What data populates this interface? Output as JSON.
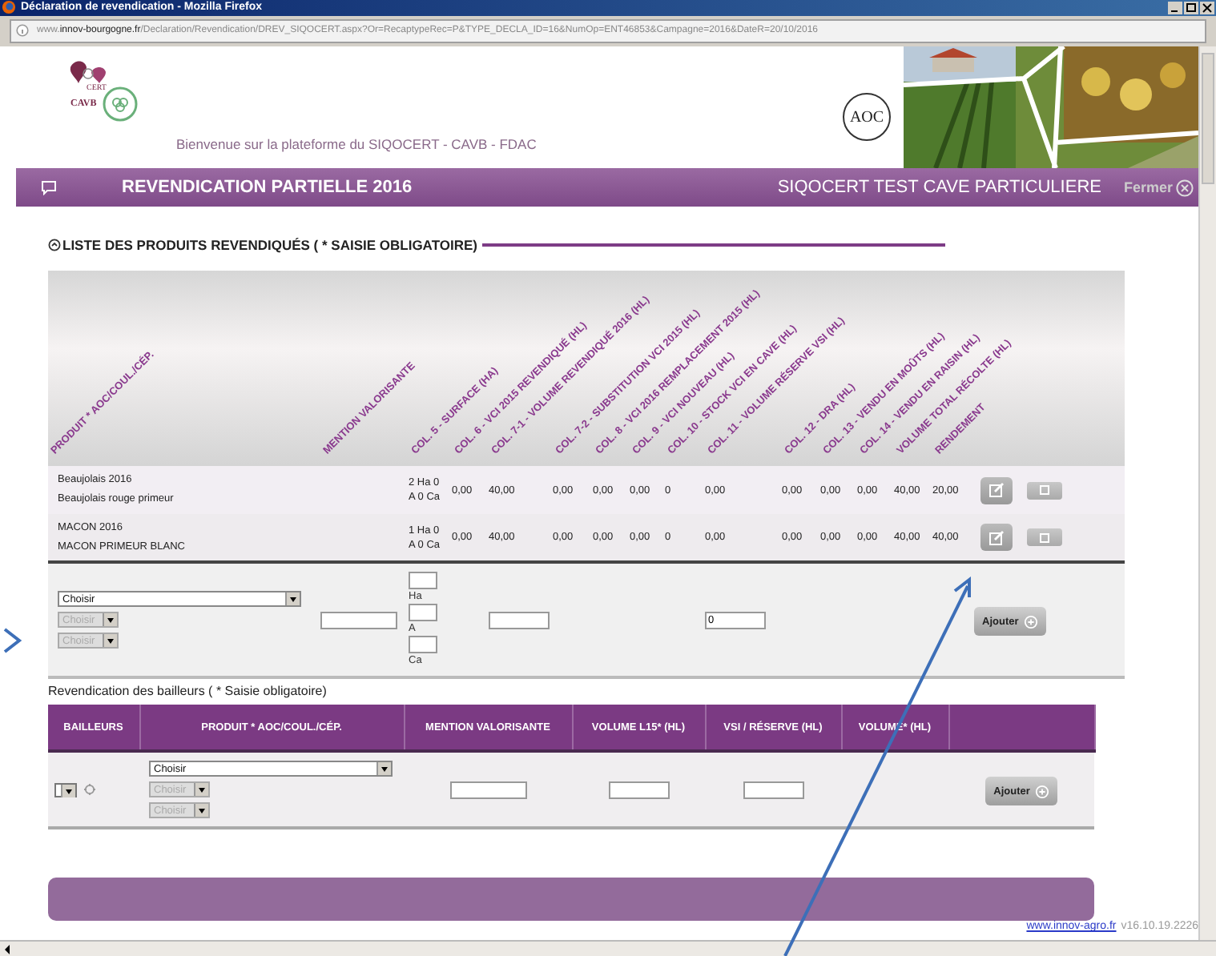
{
  "browser": {
    "title": "Déclaration de revendication - Mozilla Firefox",
    "url": "www.**innov-bourgogne.fr**/Declaration/Revendication/DREV_SIQOCERT.aspx?Or=RecaptypeRec=P&TYPE_DECLA_ID=16&NumOp=ENT46853&Campagne=2016&DateR=20/10/2016"
  },
  "header": {
    "logo_texts": [
      "CERT",
      "CAVB"
    ],
    "welcome": "Bienvenue sur la plateforme du SIQOCERT - CAVB - FDAC",
    "seal": "AOC",
    "banner": {
      "kind": "picture"
    }
  },
  "top_bar": {
    "title": "REVENDICATION PARTIELLE 2016",
    "operator": "SIQOCERT TEST CAVE PARTICULIERE",
    "close": "Fermer"
  },
  "products": {
    "title": "LISTE DES PRODUITS REVENDIQUÉS ( * SAISIE OBLIGATOIRE)",
    "columns": [
      "PRODUIT * AOC/COUL./CÉP.",
      "MENTION VALORISANTE",
      "COL. 5 - SURFACE (HA)",
      "COL. 6 - VCI 2015 REVENDIQUÉ (HL)",
      "COL. 7-1 - VOLUME REVENDIQUÉ 2016 (HL)",
      "COL. 7-2 - SUBSTITUTION VCI 2015 (HL)",
      "COL. 8 - VCI 2016 REMPLACEMENT 2015 (HL)",
      "COL. 9 - VCI NOUVEAU (HL)",
      "COL. 10 - STOCK VCI EN CAVE (HL)",
      "COL. 11 - VOLUME RÉSERVE VSI (HL)",
      "COL. 12 - DRA (HL)",
      "COL. 13 - VENDU EN MOÛTS (HL)",
      "COL. 14 - VENDU EN RAISIN (HL)",
      "VOLUME TOTAL RÉCOLTE (HL)",
      "RENDEMENT"
    ],
    "rows": [
      {
        "product": "Beaujolais 2016",
        "detail": "Beaujolais rouge primeur",
        "surface": [
          "2 Ha 0",
          "A 0 Ca"
        ],
        "values": [
          "0,00",
          "40,00",
          "0,00",
          "0,00",
          "0,00",
          "0",
          "0,00",
          "0,00",
          "0,00",
          "0,00",
          "40,00",
          "20,00"
        ]
      },
      {
        "product": "MACON 2016",
        "detail": "MACON PRIMEUR BLANC",
        "surface": [
          "1 Ha 0",
          "A 0 Ca"
        ],
        "values": [
          "0,00",
          "40,00",
          "0,00",
          "0,00",
          "0,00",
          "0",
          "0,00",
          "0,00",
          "0,00",
          "0,00",
          "40,00",
          "40,00"
        ]
      }
    ],
    "entry": {
      "product": "Choisir",
      "sub_selects": [
        {
          "value": "Choisir",
          "disabled": true
        },
        {
          "value": "Choisir",
          "disabled": true
        }
      ],
      "surface_units": [
        "Ha",
        "A",
        "Ca"
      ],
      "reserve": "0",
      "button": "Ajouter"
    }
  },
  "lessors": {
    "title": "Revendication des bailleurs ( * Saisie obligatoire)",
    "columns": [
      "BAILLEURS",
      "PRODUIT * AOC/COUL./CÉP.",
      "MENTION VALORISANTE",
      "VOLUME L15* (HL)",
      "VSI / RÉSERVE (HL)",
      "VOLUME* (HL)"
    ],
    "entry": {
      "product": "Choisir",
      "sub_selects": [
        {
          "value": "Choisir",
          "disabled": true
        },
        {
          "value": "Choisir",
          "disabled": true
        }
      ],
      "button": "Ajouter"
    }
  },
  "footer": {
    "link": "www.innov-agro.fr",
    "version": "v16.10.19.2226"
  }
}
